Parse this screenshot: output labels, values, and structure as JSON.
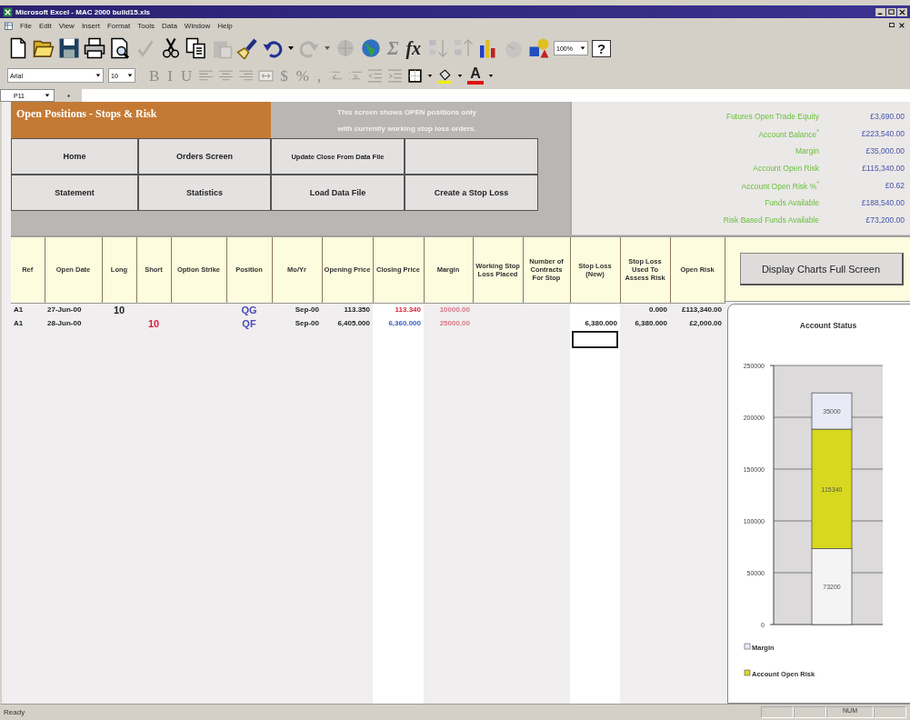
{
  "window": {
    "title": "Microsoft Excel - MAC 2000 build15.xls"
  },
  "menu": [
    "File",
    "Edit",
    "View",
    "Insert",
    "Format",
    "Tools",
    "Data",
    "Window",
    "Help"
  ],
  "standard_toolbar": [
    {
      "kind": "new",
      "disabled": false
    },
    {
      "kind": "open",
      "disabled": false
    },
    {
      "kind": "save",
      "disabled": false
    },
    {
      "kind": "print",
      "disabled": false
    },
    {
      "kind": "preview",
      "disabled": false
    },
    {
      "kind": "spelling",
      "disabled": true
    },
    {
      "kind": "cut",
      "disabled": false
    },
    {
      "kind": "copy",
      "disabled": false
    },
    {
      "kind": "paste",
      "disabled": true
    },
    {
      "kind": "painter",
      "disabled": false
    },
    {
      "kind": "undo",
      "disabled": false
    },
    {
      "kind": "caret",
      "disabled": false
    },
    {
      "kind": "redo",
      "disabled": true
    },
    {
      "kind": "caret",
      "disabled": true
    },
    {
      "kind": "hyperlink",
      "disabled": true
    },
    {
      "kind": "web",
      "disabled": false
    },
    {
      "kind": "glyph",
      "label": "Σ",
      "disabled": true
    },
    {
      "kind": "glyph",
      "label": "fx",
      "disabled": false
    },
    {
      "kind": "sort-asc",
      "disabled": true
    },
    {
      "kind": "sort-desc",
      "disabled": true
    },
    {
      "kind": "chart",
      "disabled": false
    },
    {
      "kind": "map",
      "disabled": true
    },
    {
      "kind": "drawing",
      "disabled": false
    },
    {
      "kind": "combo",
      "label": "100%",
      "disabled": false
    },
    {
      "kind": "help",
      "label": "?",
      "disabled": false
    }
  ],
  "formatting_toolbar": [
    {
      "kind": "font",
      "label": "Arial",
      "disabled": false
    },
    {
      "kind": "size",
      "label": "10",
      "disabled": false
    },
    {
      "kind": "glyph",
      "label": "B",
      "disabled": true
    },
    {
      "kind": "glyph",
      "label": "I",
      "disabled": true
    },
    {
      "kind": "glyph",
      "label": "U",
      "disabled": true
    },
    {
      "kind": "align-left",
      "disabled": true
    },
    {
      "kind": "align-center",
      "disabled": true
    },
    {
      "kind": "align-right",
      "disabled": true
    },
    {
      "kind": "merge",
      "disabled": true
    },
    {
      "kind": "glyph",
      "label": "$",
      "disabled": true
    },
    {
      "kind": "glyph",
      "label": "%",
      "disabled": true
    },
    {
      "kind": "glyph",
      "label": ",",
      "disabled": true
    },
    {
      "kind": "inc-decimal",
      "disabled": true
    },
    {
      "kind": "dec-decimal",
      "disabled": true
    },
    {
      "kind": "outdent",
      "disabled": true
    },
    {
      "kind": "indent",
      "disabled": true
    },
    {
      "kind": "borders",
      "disabled": false
    },
    {
      "kind": "caret",
      "disabled": false
    },
    {
      "kind": "fill",
      "disabled": false
    },
    {
      "kind": "caret",
      "disabled": false
    },
    {
      "kind": "font-color",
      "label": "A",
      "disabled": false
    },
    {
      "kind": "caret",
      "disabled": false
    }
  ],
  "name_box": "P11",
  "sheet": {
    "title": "Open Positions - Stops & Risk",
    "notice": [
      "This screen shows OPEN positions only",
      "with currently working stop loss orders."
    ],
    "nav_buttons": [
      [
        "Home",
        "Orders Screen",
        "Update Close From Data File"
      ],
      [
        "Statement",
        "Statistics",
        "Load Data File",
        "Create a Stop Loss"
      ]
    ],
    "summary": [
      {
        "label": "Futures Open Trade Equity",
        "value": "£3,690.00"
      },
      {
        "label": "Account Balance$^{*}$",
        "value": "£223,540.00"
      },
      {
        "label": "Margin",
        "value": "£35,000.00"
      },
      {
        "label": "Account Open Risk",
        "value": "£115,340.00"
      },
      {
        "label": "Account Open Risk %$^{*}$",
        "value": "£0.62"
      },
      {
        "label": "Funds Available",
        "value": "£188,540.00"
      },
      {
        "label": "Risk Based Funds Available",
        "value": "£73,200.00"
      }
    ],
    "chart_button": "Display Charts Full Screen"
  },
  "table": {
    "columns": [
      {
        "label": "Ref",
        "editable": false,
        "selected": false
      },
      {
        "label": "Open Date",
        "editable": false,
        "selected": false
      },
      {
        "label": "Long",
        "editable": false,
        "selected": false
      },
      {
        "label": "Short",
        "editable": false,
        "selected": false
      },
      {
        "label": "Option Strike",
        "editable": false,
        "selected": false
      },
      {
        "label": "Position",
        "editable": false,
        "selected": false
      },
      {
        "label": "Mo/Yr",
        "editable": false,
        "selected": false
      },
      {
        "label": "Opening Price",
        "editable": false,
        "selected": false
      },
      {
        "label": "Closing Price",
        "editable": true,
        "selected": false
      },
      {
        "label": "Margin",
        "editable": false,
        "selected": false
      },
      {
        "label": "Working Stop Loss Placed",
        "editable": false,
        "selected": false
      },
      {
        "label": "Number of Contracts For Stop",
        "editable": false,
        "selected": false
      },
      {
        "label": "Stop Loss (New)",
        "editable": true,
        "selected": true
      },
      {
        "label": "Stop Loss Used To Assess Risk",
        "editable": false,
        "selected": false
      },
      {
        "label": "Open Risk",
        "editable": false,
        "selected": false
      }
    ],
    "rows": [
      {
        "cells": [
          "A1",
          "27-Jun-00",
          "10",
          null,
          null,
          {
            "text": "QG",
            "color": "#4a4ab8"
          },
          "Sep-00",
          "113.350",
          {
            "text": "113.340",
            "color": "#e02040"
          },
          {
            "text": "10000.00",
            "color": "#d87888"
          },
          null,
          null,
          null,
          "0.000",
          "£113,340.00"
        ]
      },
      {
        "cells": [
          "A1",
          "28-Jun-00",
          null,
          {
            "text": "10",
            "color": "#e02040"
          },
          null,
          {
            "text": "QF",
            "color": "#4a4ab8"
          },
          "Sep-00",
          "6,405.000",
          {
            "text": "6,360.000",
            "color": "#3a5cc0"
          },
          {
            "text": "25000.00",
            "color": "#d87888"
          },
          null,
          null,
          "6,380.000",
          "6,380.000",
          "£2,000.00"
        ]
      }
    ]
  },
  "chart_data": {
    "type": "bar",
    "title": "Account Status",
    "stacked": true,
    "data_labels": true,
    "grid": true,
    "legend": true,
    "ylim": [
      0,
      250000
    ],
    "yticks": [
      0,
      50000,
      100000,
      150000,
      200000,
      250000
    ],
    "series": [
      {
        "color": "#f4f4f4",
        "values": [
          73200
        ]
      },
      {
        "name": "Account Open Risk",
        "color": "#d8d820",
        "values": [
          115340
        ]
      },
      {
        "name": "Margin",
        "color": "#e8eaf6",
        "values": [
          35000
        ]
      }
    ]
  },
  "status_bar": {
    "message": "Ready",
    "num_lock": "NUM"
  }
}
